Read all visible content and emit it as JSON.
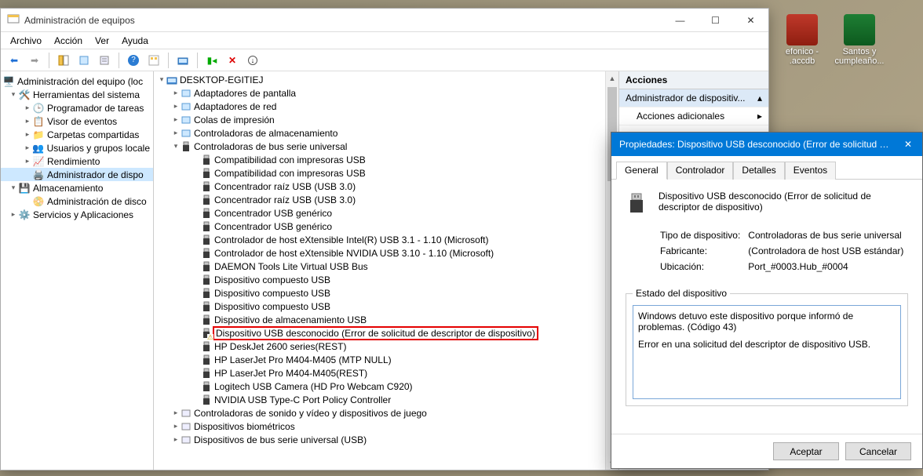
{
  "desktop": {
    "icons": [
      {
        "name": "efonico - .accdb",
        "type": "access"
      },
      {
        "name": "Santos y cumpleaño...",
        "type": "excel"
      }
    ]
  },
  "mmc": {
    "title": "Administración de equipos",
    "menu": [
      "Archivo",
      "Acción",
      "Ver",
      "Ayuda"
    ],
    "nav": {
      "root": "Administración del equipo (loc",
      "sys_tools": "Herramientas del sistema",
      "sys_children": [
        "Programador de tareas",
        "Visor de eventos",
        "Carpetas compartidas",
        "Usuarios y grupos locale",
        "Rendimiento",
        "Administrador de dispo"
      ],
      "storage": "Almacenamiento",
      "storage_children": [
        "Administración de disco"
      ],
      "services": "Servicios y Aplicaciones"
    },
    "devtree": {
      "root": "DESKTOP-EGITIEJ",
      "top_collapsed": [
        "Adaptadores de pantalla",
        "Adaptadores de red",
        "Colas de impresión",
        "Controladoras de almacenamiento"
      ],
      "usb_ctrl": "Controladoras de bus serie universal",
      "usb_children": [
        "Compatibilidad con impresoras USB",
        "Compatibilidad con impresoras USB",
        "Concentrador raíz USB (USB 3.0)",
        "Concentrador raíz USB (USB 3.0)",
        "Concentrador USB genérico",
        "Concentrador USB genérico",
        "Controlador de host eXtensible Intel(R) USB 3.1 - 1.10 (Microsoft)",
        "Controlador de host eXtensible NVIDIA USB 3.10 - 1.10 (Microsoft)",
        "DAEMON Tools Lite Virtual USB Bus",
        "Dispositivo compuesto USB",
        "Dispositivo compuesto USB",
        "Dispositivo compuesto USB",
        "Dispositivo de almacenamiento USB",
        "Dispositivo USB desconocido (Error de solicitud de descriptor de dispositivo)",
        "HP DeskJet 2600 series(REST)",
        "HP LaserJet Pro M404-M405 (MTP NULL)",
        "HP LaserJet Pro M404-M405(REST)",
        "Logitech USB Camera (HD Pro Webcam C920)",
        "NVIDIA USB Type-C Port Policy Controller"
      ],
      "bottom_collapsed": [
        "Controladoras de sonido y vídeo y dispositivos de juego",
        "Dispositivos biométricos",
        "Dispositivos de bus serie universal (USB)"
      ]
    },
    "actions": {
      "header": "Acciones",
      "primary": "Administrador de dispositiv...",
      "secondary": "Acciones adicionales"
    }
  },
  "props": {
    "title": "Propiedades: Dispositivo USB desconocido (Error de solicitud de descriptor de d...",
    "tabs": [
      "General",
      "Controlador",
      "Detalles",
      "Eventos"
    ],
    "device_name": "Dispositivo USB desconocido (Error de solicitud de descriptor de dispositivo)",
    "fields": {
      "type_label": "Tipo de dispositivo:",
      "type_value": "Controladoras de bus serie universal",
      "vendor_label": "Fabricante:",
      "vendor_value": "(Controladora de host USB estándar)",
      "location_label": "Ubicación:",
      "location_value": "Port_#0003.Hub_#0004"
    },
    "status_label": "Estado del dispositivo",
    "status_text_1": "Windows detuvo este dispositivo porque informó de problemas. (Código 43)",
    "status_text_2": "Error en una solicitud del descriptor de dispositivo USB.",
    "buttons": {
      "ok": "Aceptar",
      "cancel": "Cancelar"
    }
  }
}
